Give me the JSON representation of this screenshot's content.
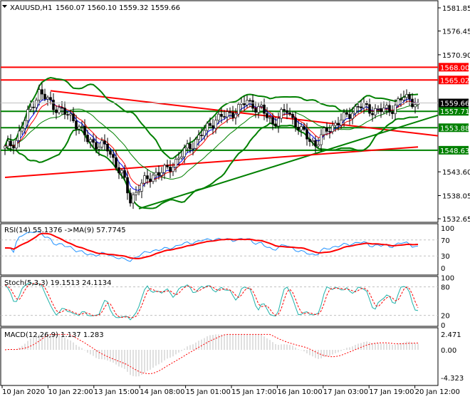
{
  "header": {
    "symbol": "XAUUSD,H1",
    "ohlc": "1560.07 1560.10 1559.32 1559.66"
  },
  "colors": {
    "up": "#ffffff",
    "down": "#000000",
    "support": "#008000",
    "resistance": "#ff0000",
    "bands": "#008000",
    "rsi": "#1e90ff",
    "signal": "#ff0000",
    "stoch": "#20b2aa",
    "hist": "#c0c0c0"
  },
  "chart_data": [
    {
      "type": "line",
      "title": "XAUUSD,H1 candlestick",
      "ylim": [
        1532.65,
        1581.85
      ],
      "yticks": [
        "1581.85",
        "1576.45",
        "1570.90",
        "1543.60",
        "1538.05",
        "1532.65"
      ],
      "xticks": [
        "10 Jan 2020",
        "10 Jan 22:00",
        "13 Jan 15:00",
        "14 Jan 08:00",
        "15 Jan 01:00",
        "15 Jan 17:00",
        "16 Jan 10:00",
        "17 Jan 03:00",
        "17 Jan 19:00",
        "20 Jan 12:00"
      ],
      "close_keypoints": [
        [
          0,
          1549
        ],
        [
          4,
          1551
        ],
        [
          10,
          1560
        ],
        [
          12,
          1562
        ],
        [
          19,
          1558
        ],
        [
          24,
          1556
        ],
        [
          29,
          1551
        ],
        [
          36,
          1549
        ],
        [
          41,
          1543
        ],
        [
          44,
          1537
        ],
        [
          47,
          1540
        ],
        [
          52,
          1543
        ],
        [
          57,
          1544
        ],
        [
          64,
          1549
        ],
        [
          70,
          1553
        ],
        [
          74,
          1556
        ],
        [
          79,
          1557
        ],
        [
          85,
          1560
        ],
        [
          90,
          1558
        ],
        [
          94,
          1555
        ],
        [
          99,
          1558
        ],
        [
          104,
          1553
        ],
        [
          109,
          1550
        ],
        [
          114,
          1554
        ],
        [
          119,
          1556
        ],
        [
          124,
          1559
        ],
        [
          129,
          1558
        ],
        [
          135,
          1558
        ],
        [
          140,
          1561
        ],
        [
          145,
          1559.66
        ]
      ],
      "current_price": "1559.66",
      "levels": [
        {
          "price": 1568.0,
          "label": "1568.00",
          "kind": "resistance"
        },
        {
          "price": 1565.02,
          "label": "1565.02",
          "kind": "resistance"
        },
        {
          "price": 1557.71,
          "label": "1557.71",
          "kind": "support"
        },
        {
          "price": 1553.88,
          "label": "1553.88",
          "kind": "support"
        },
        {
          "price": 1548.63,
          "label": "1548.63",
          "kind": "support"
        }
      ],
      "trendlines": [
        {
          "kind": "resistance",
          "from": [
            16,
            1562.5
          ],
          "to": [
            152,
            1552
          ]
        },
        {
          "kind": "support",
          "from": [
            47,
            1535
          ],
          "to": [
            152,
            1556.8
          ]
        },
        {
          "kind": "resistance",
          "from": [
            0,
            1542.3
          ],
          "to": [
            145,
            1549.4
          ]
        }
      ]
    },
    {
      "type": "line",
      "title": "RSI(14) 55.1376  ->MA(9) 57.7745",
      "ylim": [
        0,
        100
      ],
      "yticks": [
        "100",
        "70",
        "30",
        "0"
      ],
      "levels": [
        70,
        30
      ]
    },
    {
      "type": "line",
      "title": "Stoch(5,3,3) 19.1513 24.1134",
      "ylim": [
        0,
        100
      ],
      "yticks": [
        "100",
        "80",
        "20",
        "0"
      ],
      "levels": [
        80,
        20
      ]
    },
    {
      "type": "bar",
      "title": "MACD(12,26,9) 1.137 1.283",
      "ylim": [
        -4.323,
        2.471
      ],
      "yticks": [
        "2.471",
        "0.00",
        "-4.323"
      ]
    }
  ]
}
